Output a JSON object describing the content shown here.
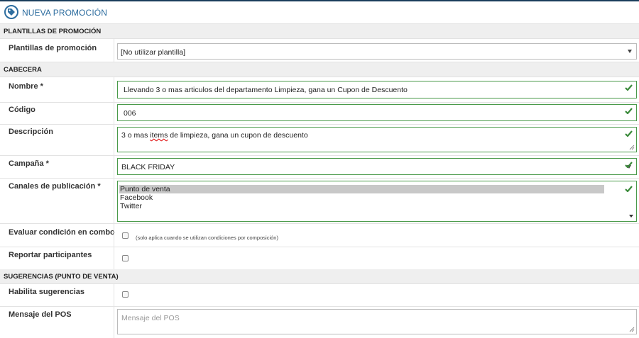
{
  "header": {
    "title": "NUEVA PROMOCIÓN",
    "icon": "tag-icon"
  },
  "sections": {
    "plantillas": "PLANTILLAS DE PROMOCIÓN",
    "cabecera": "CABECERA",
    "sugerencias": "SUGERENCIAS (PUNTO DE VENTA)"
  },
  "fields": {
    "plantillas": {
      "label": "Plantillas de promoción",
      "value": "[No utilizar plantilla]"
    },
    "nombre": {
      "label": "Nombre *",
      "value": "Llevando 3 o mas articulos del departamento Limpieza, gana un Cupon de Descuento"
    },
    "codigo": {
      "label": "Código",
      "value": "006"
    },
    "descripcion": {
      "label": "Descripción",
      "value_before": "3 o mas ",
      "value_spell": "items",
      "value_after": " de limpieza, gana un cupon de descuento"
    },
    "campana": {
      "label": "Campaña *",
      "value": "BLACK FRIDAY"
    },
    "canales": {
      "label": "Canales de publicación *",
      "options": [
        "Punto de venta",
        "Facebook",
        "Twitter"
      ],
      "selected": "Punto de venta"
    },
    "evaluar": {
      "label": "Evaluar condición en combo",
      "note": "(solo aplica cuando se utilizan condiciones por composición)",
      "checked": false
    },
    "reportar": {
      "label": "Reportar participantes",
      "checked": false
    },
    "habilita": {
      "label": "Habilita sugerencias",
      "checked": false
    },
    "mensaje": {
      "label": "Mensaje del POS",
      "placeholder": "Mensaje del POS",
      "value": ""
    }
  },
  "colors": {
    "accent": "#2d6d9f",
    "valid_border": "#4a9a4a",
    "check": "#3a8a3a",
    "section_bg": "#efefef"
  }
}
